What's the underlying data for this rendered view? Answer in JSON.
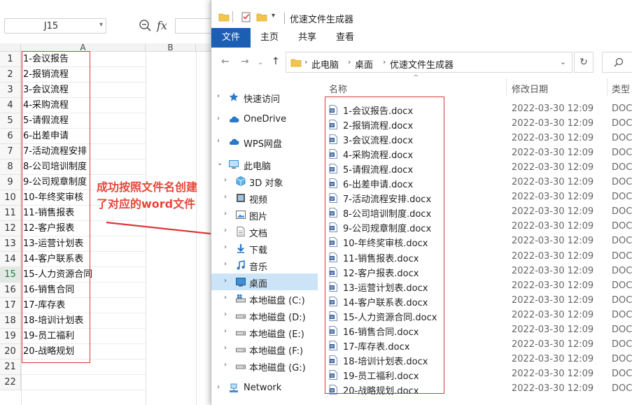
{
  "spreadsheet": {
    "name_box": "J15",
    "column_headers": [
      "A",
      "B"
    ],
    "active_row": "15",
    "rows": [
      {
        "num": "1",
        "value": "1-会议报告"
      },
      {
        "num": "2",
        "value": "2-报销流程"
      },
      {
        "num": "3",
        "value": "3-会议流程"
      },
      {
        "num": "4",
        "value": "4-采购流程"
      },
      {
        "num": "5",
        "value": "5-请假流程"
      },
      {
        "num": "6",
        "value": "6-出差申请"
      },
      {
        "num": "7",
        "value": "7-活动流程安排"
      },
      {
        "num": "8",
        "value": "8-公司培训制度"
      },
      {
        "num": "9",
        "value": "9-公司规章制度"
      },
      {
        "num": "10",
        "value": "10-年终奖审核"
      },
      {
        "num": "11",
        "value": "11-销售报表"
      },
      {
        "num": "12",
        "value": "12-客户报表"
      },
      {
        "num": "13",
        "value": "13-运营计划表"
      },
      {
        "num": "14",
        "value": "14-客户联系表"
      },
      {
        "num": "15",
        "value": "15-人力资源合同"
      },
      {
        "num": "16",
        "value": "16-销售合同"
      },
      {
        "num": "17",
        "value": "17-库存表"
      },
      {
        "num": "18",
        "value": "18-培训计划表"
      },
      {
        "num": "19",
        "value": "19-员工福利"
      },
      {
        "num": "20",
        "value": "20-战略规划"
      },
      {
        "num": "21",
        "value": ""
      },
      {
        "num": "22",
        "value": ""
      }
    ]
  },
  "annotation": {
    "line1": "成功按照文件名创建",
    "line2": "了对应的word文件"
  },
  "explorer": {
    "title": "优速文件生成器",
    "ribbon_tabs": [
      "文件",
      "主页",
      "共享",
      "查看"
    ],
    "breadcrumb": [
      "此电脑",
      "桌面",
      "优速文件生成器"
    ],
    "columns": {
      "name": "名称",
      "date": "修改日期",
      "type": "类型"
    },
    "nav_items": [
      {
        "label": "快速访问",
        "icon": "star-icon",
        "chevron": "›"
      },
      {
        "label": "OneDrive",
        "icon": "cloud-icon",
        "chevron": "›"
      },
      {
        "label": "WPS网盘",
        "icon": "cloud-icon",
        "chevron": "›"
      },
      {
        "label": "此电脑",
        "icon": "computer-icon",
        "chevron": "⌄"
      },
      {
        "label": "3D 对象",
        "icon": "cube-icon",
        "chevron": "›"
      },
      {
        "label": "视频",
        "icon": "video-icon",
        "chevron": "›"
      },
      {
        "label": "图片",
        "icon": "picture-icon",
        "chevron": "›"
      },
      {
        "label": "文档",
        "icon": "document-icon",
        "chevron": "›"
      },
      {
        "label": "下载",
        "icon": "download-icon",
        "chevron": "›"
      },
      {
        "label": "音乐",
        "icon": "music-icon",
        "chevron": "›"
      },
      {
        "label": "桌面",
        "icon": "desktop-icon",
        "chevron": "›",
        "selected": true
      },
      {
        "label": "本地磁盘 (C:)",
        "icon": "windows-drive-icon",
        "chevron": "›"
      },
      {
        "label": "本地磁盘 (D:)",
        "icon": "drive-icon",
        "chevron": "›"
      },
      {
        "label": "本地磁盘 (E:)",
        "icon": "drive-icon",
        "chevron": "›"
      },
      {
        "label": "本地磁盘 (F:)",
        "icon": "drive-icon",
        "chevron": "›"
      },
      {
        "label": "本地磁盘 (G:)",
        "icon": "drive-icon",
        "chevron": "›"
      },
      {
        "label": "Network",
        "icon": "network-icon",
        "chevron": "›"
      }
    ],
    "files": [
      {
        "name": "1-会议报告.docx",
        "date": "2022-03-30 12:09",
        "type": "DOCX"
      },
      {
        "name": "2-报销流程.docx",
        "date": "2022-03-30 12:09",
        "type": "DOCX"
      },
      {
        "name": "3-会议流程.docx",
        "date": "2022-03-30 12:09",
        "type": "DOCX"
      },
      {
        "name": "4-采购流程.docx",
        "date": "2022-03-30 12:09",
        "type": "DOCX"
      },
      {
        "name": "5-请假流程.docx",
        "date": "2022-03-30 12:09",
        "type": "DOCX"
      },
      {
        "name": "6-出差申请.docx",
        "date": "2022-03-30 12:09",
        "type": "DOCX"
      },
      {
        "name": "7-活动流程安排.docx",
        "date": "2022-03-30 12:09",
        "type": "DOCX"
      },
      {
        "name": "8-公司培训制度.docx",
        "date": "2022-03-30 12:09",
        "type": "DOCX"
      },
      {
        "name": "9-公司规章制度.docx",
        "date": "2022-03-30 12:09",
        "type": "DOCX"
      },
      {
        "name": "10-年终奖审核.docx",
        "date": "2022-03-30 12:09",
        "type": "DOCX"
      },
      {
        "name": "11-销售报表.docx",
        "date": "2022-03-30 12:09",
        "type": "DOCX"
      },
      {
        "name": "12-客户报表.docx",
        "date": "2022-03-30 12:09",
        "type": "DOCX"
      },
      {
        "name": "13-运营计划表.docx",
        "date": "2022-03-30 12:09",
        "type": "DOCX"
      },
      {
        "name": "14-客户联系表.docx",
        "date": "2022-03-30 12:09",
        "type": "DOCX"
      },
      {
        "name": "15-人力资源合同.docx",
        "date": "2022-03-30 12:09",
        "type": "DOCX"
      },
      {
        "name": "16-销售合同.docx",
        "date": "2022-03-30 12:09",
        "type": "DOCX"
      },
      {
        "name": "17-库存表.docx",
        "date": "2022-03-30 12:09",
        "type": "DOCX"
      },
      {
        "name": "18-培训计划表.docx",
        "date": "2022-03-30 12:09",
        "type": "DOCX"
      },
      {
        "name": "19-员工福利.docx",
        "date": "2022-03-30 12:09",
        "type": "DOCX"
      },
      {
        "name": "20-战略规划.docx",
        "date": "2022-03-30 12:09",
        "type": "DOCX"
      }
    ]
  },
  "colors": {
    "accent": "#1a5fb4",
    "highlight_red": "#e0373a",
    "annotation_red": "#e8463a",
    "nav_selected": "#cce4f7"
  }
}
